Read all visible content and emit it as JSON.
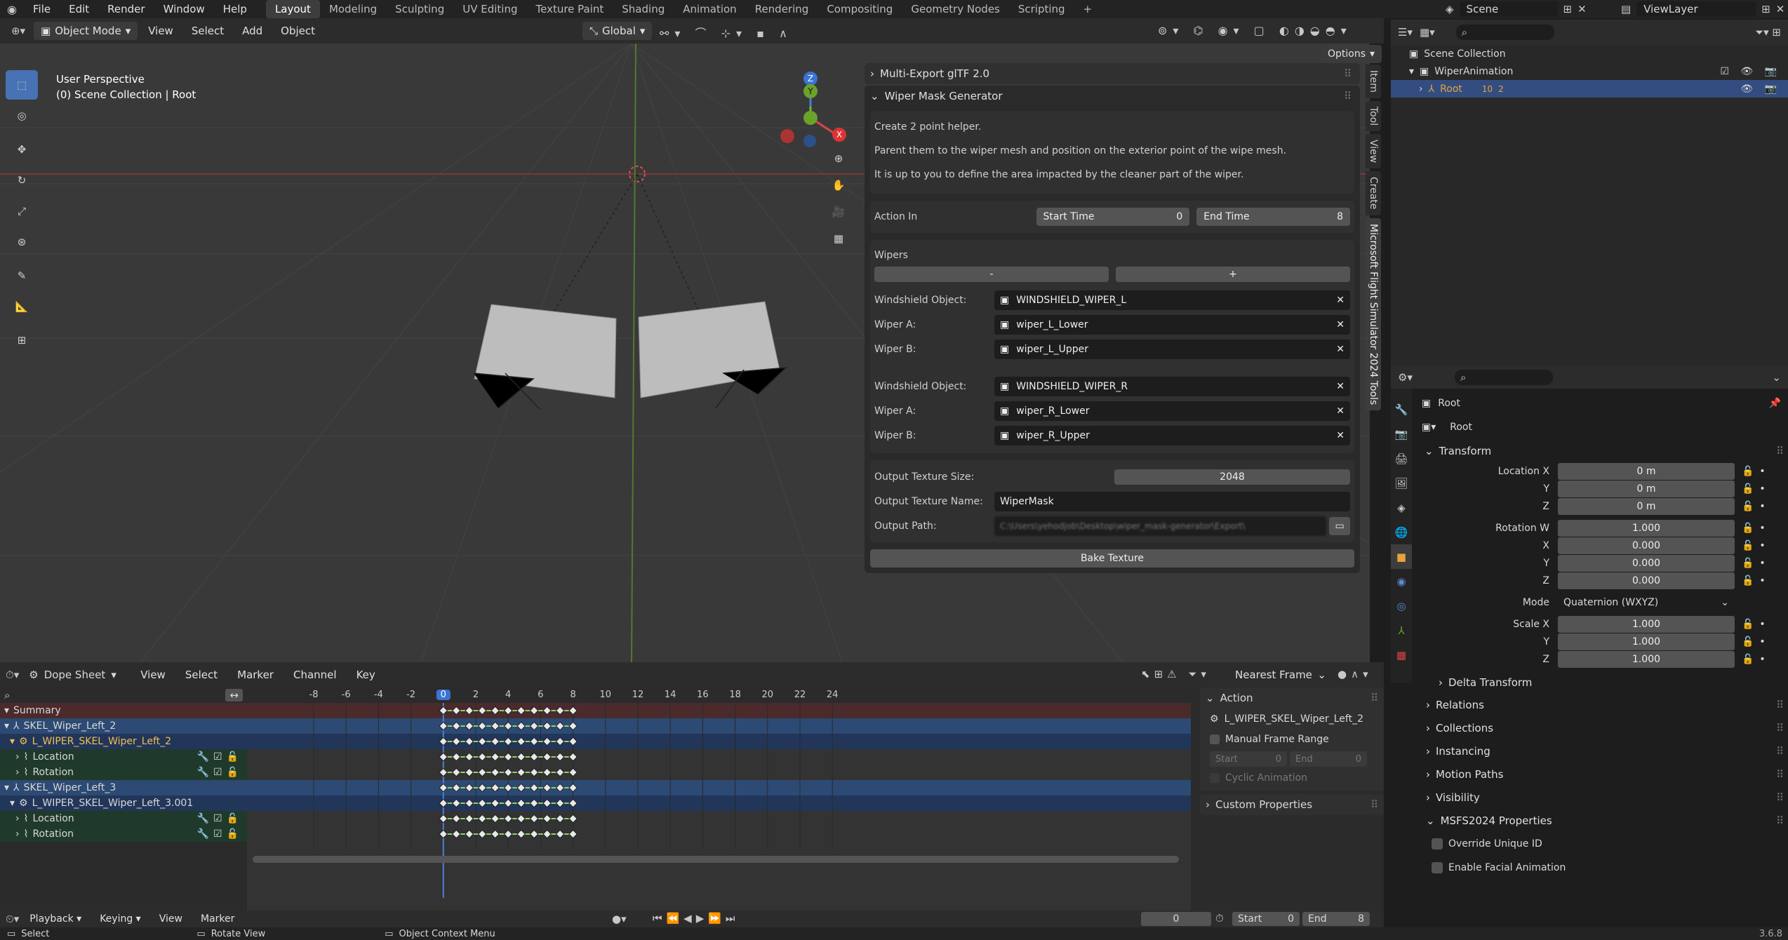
{
  "menu": [
    "File",
    "Edit",
    "Render",
    "Window",
    "Help"
  ],
  "workspaces": [
    "Layout",
    "Modeling",
    "Sculpting",
    "UV Editing",
    "Texture Paint",
    "Shading",
    "Animation",
    "Rendering",
    "Compositing",
    "Geometry Nodes",
    "Scripting"
  ],
  "active_workspace": "Layout",
  "scene": "Scene",
  "view_layer": "ViewLayer",
  "viewport": {
    "mode": "Object Mode",
    "menus": [
      "View",
      "Select",
      "Add",
      "Object"
    ],
    "orientation": "Global",
    "options": "Options",
    "info_line1": "User Perspective",
    "info_line2": "(0) Scene Collection | Root",
    "gizmo": {
      "z": "Z",
      "y": "Y",
      "x": "X"
    }
  },
  "npanel": {
    "tabs": [
      "Item",
      "Tool",
      "View",
      "Create",
      "Microsoft Flight Simulator 2024 Tools"
    ],
    "gltf_title": "Multi-Export glTF 2.0",
    "wiper_title": "Wiper Mask Generator",
    "help1": "Create 2 point helper.",
    "help2": "Parent them to the wiper mesh and position on the exterior point of the wipe mesh.",
    "help3": "It is up to you to define the area impacted by the cleaner part of the wiper.",
    "action_in": "Action In",
    "start_time_label": "Start Time",
    "start_time": "0",
    "end_time_label": "End Time",
    "end_time": "8",
    "wipers_title": "Wipers",
    "minus": "-",
    "plus": "+",
    "wipers": [
      {
        "ws_label": "Windshield Object:",
        "ws": "WINDSHIELD_WIPER_L",
        "a_label": "Wiper A:",
        "a": "wiper_L_Lower",
        "b_label": "Wiper B:",
        "b": "wiper_L_Upper"
      },
      {
        "ws_label": "Windshield Object:",
        "ws": "WINDSHIELD_WIPER_R",
        "a_label": "Wiper A:",
        "a": "wiper_R_Lower",
        "b_label": "Wiper B:",
        "b": "wiper_R_Upper"
      }
    ],
    "out_size_label": "Output Texture Size:",
    "out_size": "2048",
    "out_name_label": "Output Texture Name:",
    "out_name": "WiperMask",
    "out_path_label": "Output Path:",
    "out_path": "C:\\Users\\yehodjob\\Desktop\\wiper_mask-generator\\Export\\",
    "bake": "Bake Texture"
  },
  "outliner": {
    "root": "Scene Collection",
    "collection": "WiperAnimation",
    "object": "Root",
    "badge1": "10",
    "badge2": "2"
  },
  "props": {
    "object": "Root",
    "data_name": "Root",
    "transform": "Transform",
    "location_x_label": "Location X",
    "y_label": "Y",
    "z_label": "Z",
    "x_label": "X",
    "w_label": "Rotation W",
    "loc": [
      "0 m",
      "0 m",
      "0 m"
    ],
    "rot": [
      "1.000",
      "0.000",
      "0.000",
      "0.000"
    ],
    "mode_label": "Mode",
    "mode": "Quaternion (WXYZ)",
    "scale_label": "Scale X",
    "scale": [
      "1.000",
      "1.000",
      "1.000"
    ],
    "delta": "Delta Transform",
    "sections": [
      "Relations",
      "Collections",
      "Instancing",
      "Motion Paths",
      "Visibility",
      "MSFS2024 Properties"
    ],
    "override": "Override Unique ID",
    "facial": "Enable Facial Animation"
  },
  "dopesheet": {
    "editor": "Dope Sheet",
    "menus": [
      "View",
      "Select",
      "Marker",
      "Channel",
      "Key"
    ],
    "snap": "Nearest Frame",
    "frames": [
      "-8",
      "-6",
      "-4",
      "-2",
      "0",
      "2",
      "4",
      "6",
      "8",
      "10",
      "12",
      "14",
      "16",
      "18",
      "20",
      "22",
      "24"
    ],
    "current_frame": "0",
    "channels": [
      {
        "label": "Summary",
        "kind": "summary"
      },
      {
        "label": "SKEL_Wiper_Left_2",
        "kind": "object"
      },
      {
        "label": "L_WIPER_SKEL_Wiper_Left_2",
        "kind": "action"
      },
      {
        "label": "Location",
        "kind": "group"
      },
      {
        "label": "Rotation",
        "kind": "group"
      },
      {
        "label": "SKEL_Wiper_Left_3",
        "kind": "object"
      },
      {
        "label": "L_WIPER_SKEL_Wiper_Left_3.001",
        "kind": "action2"
      },
      {
        "label": "Location",
        "kind": "group"
      },
      {
        "label": "Rotation",
        "kind": "group"
      }
    ],
    "action_panel": {
      "title": "Action",
      "action": "L_WIPER_SKEL_Wiper_Left_2",
      "manual": "Manual Frame Range",
      "start_label": "Start",
      "start": "0",
      "end_label": "End",
      "end": "0",
      "cyclic": "Cyclic Animation",
      "custom": "Custom Properties"
    }
  },
  "timeline": {
    "menus": [
      "Playback",
      "Keying",
      "View",
      "Marker"
    ],
    "frame": "0",
    "start_label": "Start",
    "start": "0",
    "end_label": "End",
    "end": "8"
  },
  "status": {
    "select": "Select",
    "rotate": "Rotate View",
    "context": "Object Context Menu",
    "version": "3.6.8"
  }
}
